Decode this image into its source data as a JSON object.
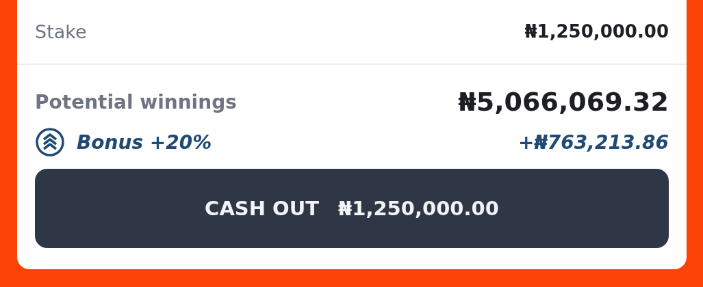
{
  "stake": {
    "label": "Stake",
    "amount": "₦1,250,000.00"
  },
  "potential_winnings": {
    "label": "Potential winnings",
    "amount": "₦5,066,069.32"
  },
  "bonus": {
    "label": "Bonus +20%",
    "amount": "+₦763,213.86"
  },
  "cash_out": {
    "label": "CASH OUT",
    "amount": "₦1,250,000.00",
    "disabled": false
  }
}
